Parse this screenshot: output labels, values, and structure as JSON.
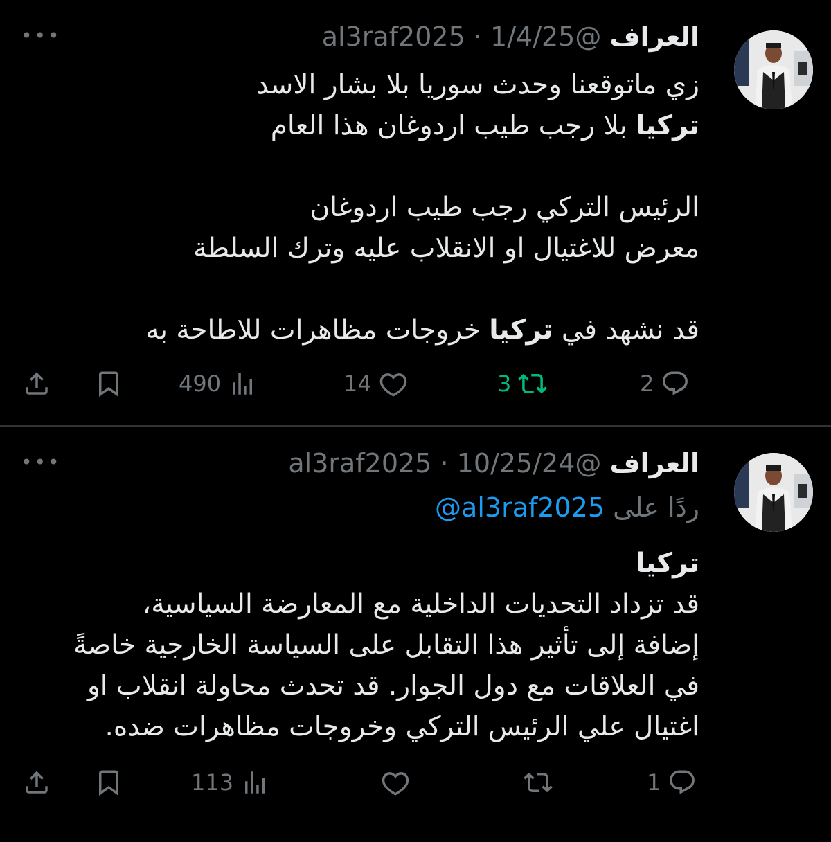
{
  "tweets": [
    {
      "display_name": "العراف",
      "handle": "@al3raf2025",
      "date": "1/4/25",
      "separator": "·",
      "body_lines": [
        [
          {
            "t": "زي ماتوقعنا وحدث سوريا بلا بشار الاسد"
          }
        ],
        [
          {
            "t": "تركيا",
            "b": true
          },
          {
            "t": " بلا رجب طيب اردوغان هذا العام"
          }
        ],
        [],
        [
          {
            "t": "الرئيس التركي رجب طيب اردوغان"
          }
        ],
        [
          {
            "t": "معرض للاغتيال او الانقلاب عليه وترك السلطة"
          }
        ],
        [],
        [
          {
            "t": "قد نشهد في "
          },
          {
            "t": "تركيا",
            "b": true
          },
          {
            "t": " خروجات مظاهرات للاطاحة به"
          }
        ]
      ],
      "replies": "2",
      "reposts": "3",
      "reposted": true,
      "likes": "14",
      "views": "490"
    },
    {
      "display_name": "العراف",
      "handle": "@al3raf2025",
      "date": "10/25/24",
      "separator": "·",
      "replying_to_label": "ردًا على",
      "replying_to_handle": "@al3raf2025",
      "body_lines": [
        [
          {
            "t": "تركيا",
            "b": true
          }
        ],
        [
          {
            "t": "قد تزداد التحديات الداخلية مع المعارضة السياسية،"
          }
        ],
        [
          {
            "t": "إضافة إلى تأثير هذا التقابل على السياسة الخارجية خاصةً"
          }
        ],
        [
          {
            "t": "في العلاقات مع دول الجوار. قد تحدث محاولة انقلاب او"
          }
        ],
        [
          {
            "t": "اغتيال علي الرئيس التركي وخروجات مظاهرات ضده."
          }
        ]
      ],
      "replies": "1",
      "reposts": "",
      "reposted": false,
      "likes": "",
      "views": "113"
    }
  ],
  "icons": {
    "more": "more-horizontal-icon",
    "reply": "reply-bubble-icon",
    "repost": "repost-icon",
    "like": "heart-icon",
    "views": "views-bar-chart-icon",
    "bookmark": "bookmark-icon",
    "share": "share-icon"
  },
  "colors": {
    "background": "#000000",
    "text": "#e7e9ea",
    "muted": "#71767b",
    "link": "#1d9bf0",
    "repost_active": "#00ba7c",
    "divider": "#2f3336"
  }
}
